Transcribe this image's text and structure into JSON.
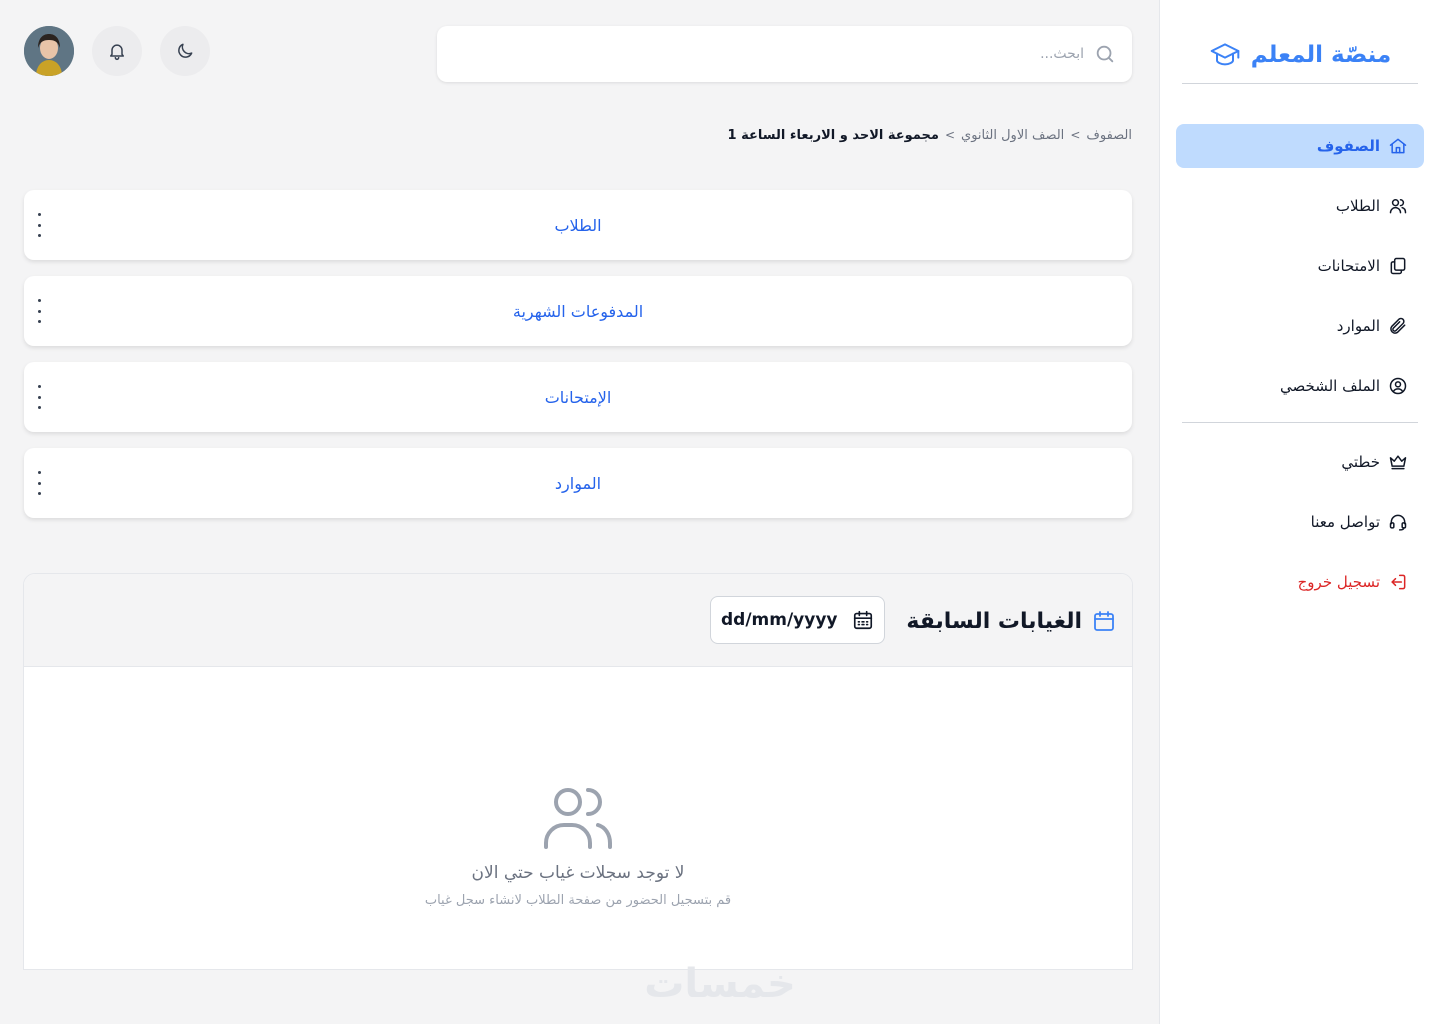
{
  "brand": {
    "title": "منصّة المعلم",
    "icon": "graduation-cap-icon",
    "color": "#3b82f6"
  },
  "sidebar": {
    "items": [
      {
        "label": "الصفوف",
        "icon": "home-icon",
        "active": true
      },
      {
        "label": "الطلاب",
        "icon": "users-icon"
      },
      {
        "label": "الامتحانات",
        "icon": "documents-icon"
      },
      {
        "label": "الموارد",
        "icon": "paperclip-icon"
      },
      {
        "label": "الملف الشخصي",
        "icon": "user-circle-icon"
      },
      {
        "label": "خطتي",
        "icon": "crown-icon"
      },
      {
        "label": "تواصل معنا",
        "icon": "headset-icon"
      },
      {
        "label": "تسجيل خروج",
        "icon": "logout-icon",
        "color": "#dc2626"
      }
    ]
  },
  "search": {
    "placeholder": "ابحث..."
  },
  "header": {
    "theme_icon": "moon-icon",
    "notifications_icon": "bell-icon"
  },
  "breadcrumb": {
    "items": [
      "الصفوف",
      "الصف الاول الثانوي",
      "مجموعة الاحد و الاربعاء الساعة 1"
    ],
    "separator": ">"
  },
  "cards": [
    {
      "title": "الطلاب"
    },
    {
      "title": "المدفوعات الشهرية"
    },
    {
      "title": "الإمتحانات"
    },
    {
      "title": "الموارد"
    }
  ],
  "absences": {
    "title": "الغيابات السابقة",
    "date_value": "dd/mm/yyyy",
    "empty_message": "لا توجد سجلات غياب حتي الان",
    "empty_hint": "قم بتسجيل الحضور من صفحة الطلاب لانشاء سجل غياب"
  },
  "watermark": "خمسات",
  "colors": {
    "accent": "#3b82f6",
    "active_bg": "#bfdbfe",
    "danger": "#dc2626"
  }
}
